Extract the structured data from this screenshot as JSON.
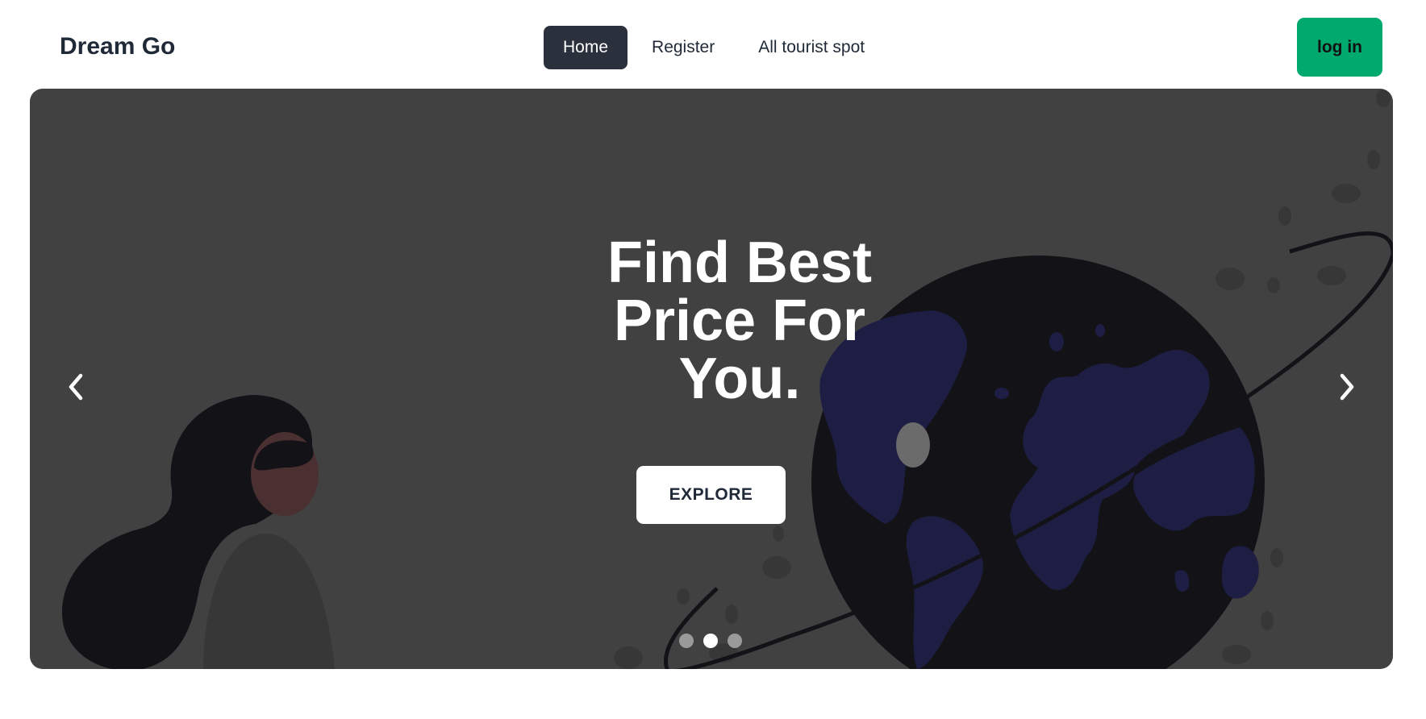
{
  "navbar": {
    "brand": "Dream Go",
    "links": [
      {
        "label": "Home",
        "active": true
      },
      {
        "label": "Register",
        "active": false
      },
      {
        "label": "All tourist spot",
        "active": false
      }
    ],
    "login_label": "log in"
  },
  "hero": {
    "title": "Find Best Price For You.",
    "cta_label": "EXPLORE",
    "prev_icon": "chevron-left-icon",
    "next_icon": "chevron-right-icon",
    "slides": 3,
    "active_slide": 2
  },
  "colors": {
    "nav_active_bg": "#2a303c",
    "login_bg": "#00a96e",
    "hero_bg": "#414141",
    "globe_dark": "#121217",
    "continents": "#1e1e44"
  }
}
